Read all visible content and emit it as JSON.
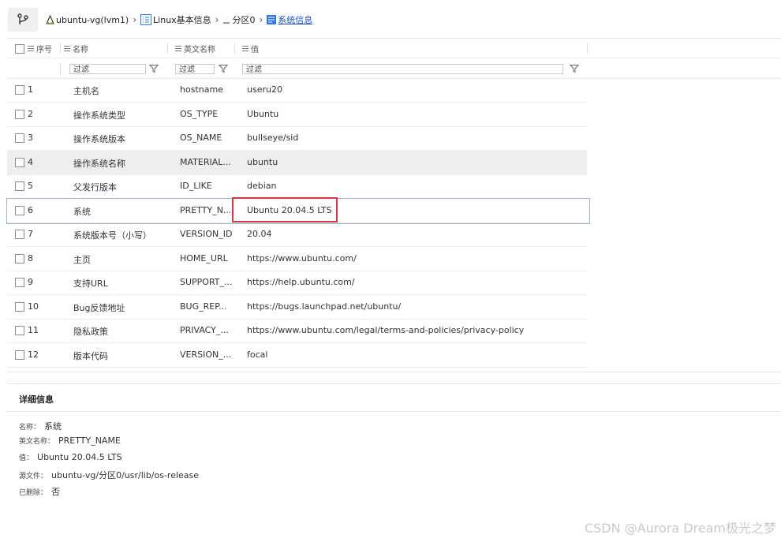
{
  "breadcrumb": [
    "ubuntu-vg(lvm1)",
    "Linux基本信息",
    "分区0",
    "系统信息"
  ],
  "columns": {
    "index": "序号",
    "name": "名称",
    "english": "英文名称",
    "value": "值"
  },
  "filter_placeholder": "过滤",
  "rows": [
    {
      "index": "1",
      "name": "主机名",
      "english": "hostname",
      "value": "useru20"
    },
    {
      "index": "2",
      "name": "操作系统类型",
      "english": "OS_TYPE",
      "value": "Ubuntu"
    },
    {
      "index": "3",
      "name": "操作系统版本",
      "english": "OS_NAME",
      "value": "bullseye/sid"
    },
    {
      "index": "4",
      "name": "操作系统名称",
      "english": "MATERIAL...",
      "value": "ubuntu"
    },
    {
      "index": "5",
      "name": "父发行版本",
      "english": "ID_LIKE",
      "value": "debian"
    },
    {
      "index": "6",
      "name": "系统",
      "english": "PRETTY_N...",
      "value": "Ubuntu 20.04.5 LTS"
    },
    {
      "index": "7",
      "name": "系统版本号（小写）",
      "english": "VERSION_ID",
      "value": "20.04"
    },
    {
      "index": "8",
      "name": "主页",
      "english": "HOME_URL",
      "value": "https://www.ubuntu.com/"
    },
    {
      "index": "9",
      "name": "支持URL",
      "english": "SUPPORT_...",
      "value": "https://help.ubuntu.com/"
    },
    {
      "index": "10",
      "name": "Bug反馈地址",
      "english": "BUG_REP...",
      "value": "https://bugs.launchpad.net/ubuntu/"
    },
    {
      "index": "11",
      "name": "隐私政策",
      "english": "PRIVACY_...",
      "value": "https://www.ubuntu.com/legal/terms-and-policies/privacy-policy"
    },
    {
      "index": "12",
      "name": "版本代码",
      "english": "VERSION_...",
      "value": "focal"
    }
  ],
  "selected_row": "4",
  "focused_row": "6",
  "detail": {
    "title": "详细信息",
    "name_label": "名称：",
    "name_value": "系统",
    "english_label": "英文名称：",
    "english_value": "PRETTY_NAME",
    "value_label": "值：",
    "value_value": "Ubuntu 20.04.5 LTS",
    "source_label": "源文件：",
    "source_value": "ubuntu-vg/分区0/usr/lib/os-release",
    "deleted_label": "已删除：",
    "deleted_value": "否"
  },
  "watermark": "CSDN @Aurora Dream极光之梦",
  "colors": {
    "link": "#1a55c8",
    "highlight_box": "#d9363e",
    "selected_row_bg": "#eeeeee",
    "focus_outline": "#9ab3da"
  }
}
